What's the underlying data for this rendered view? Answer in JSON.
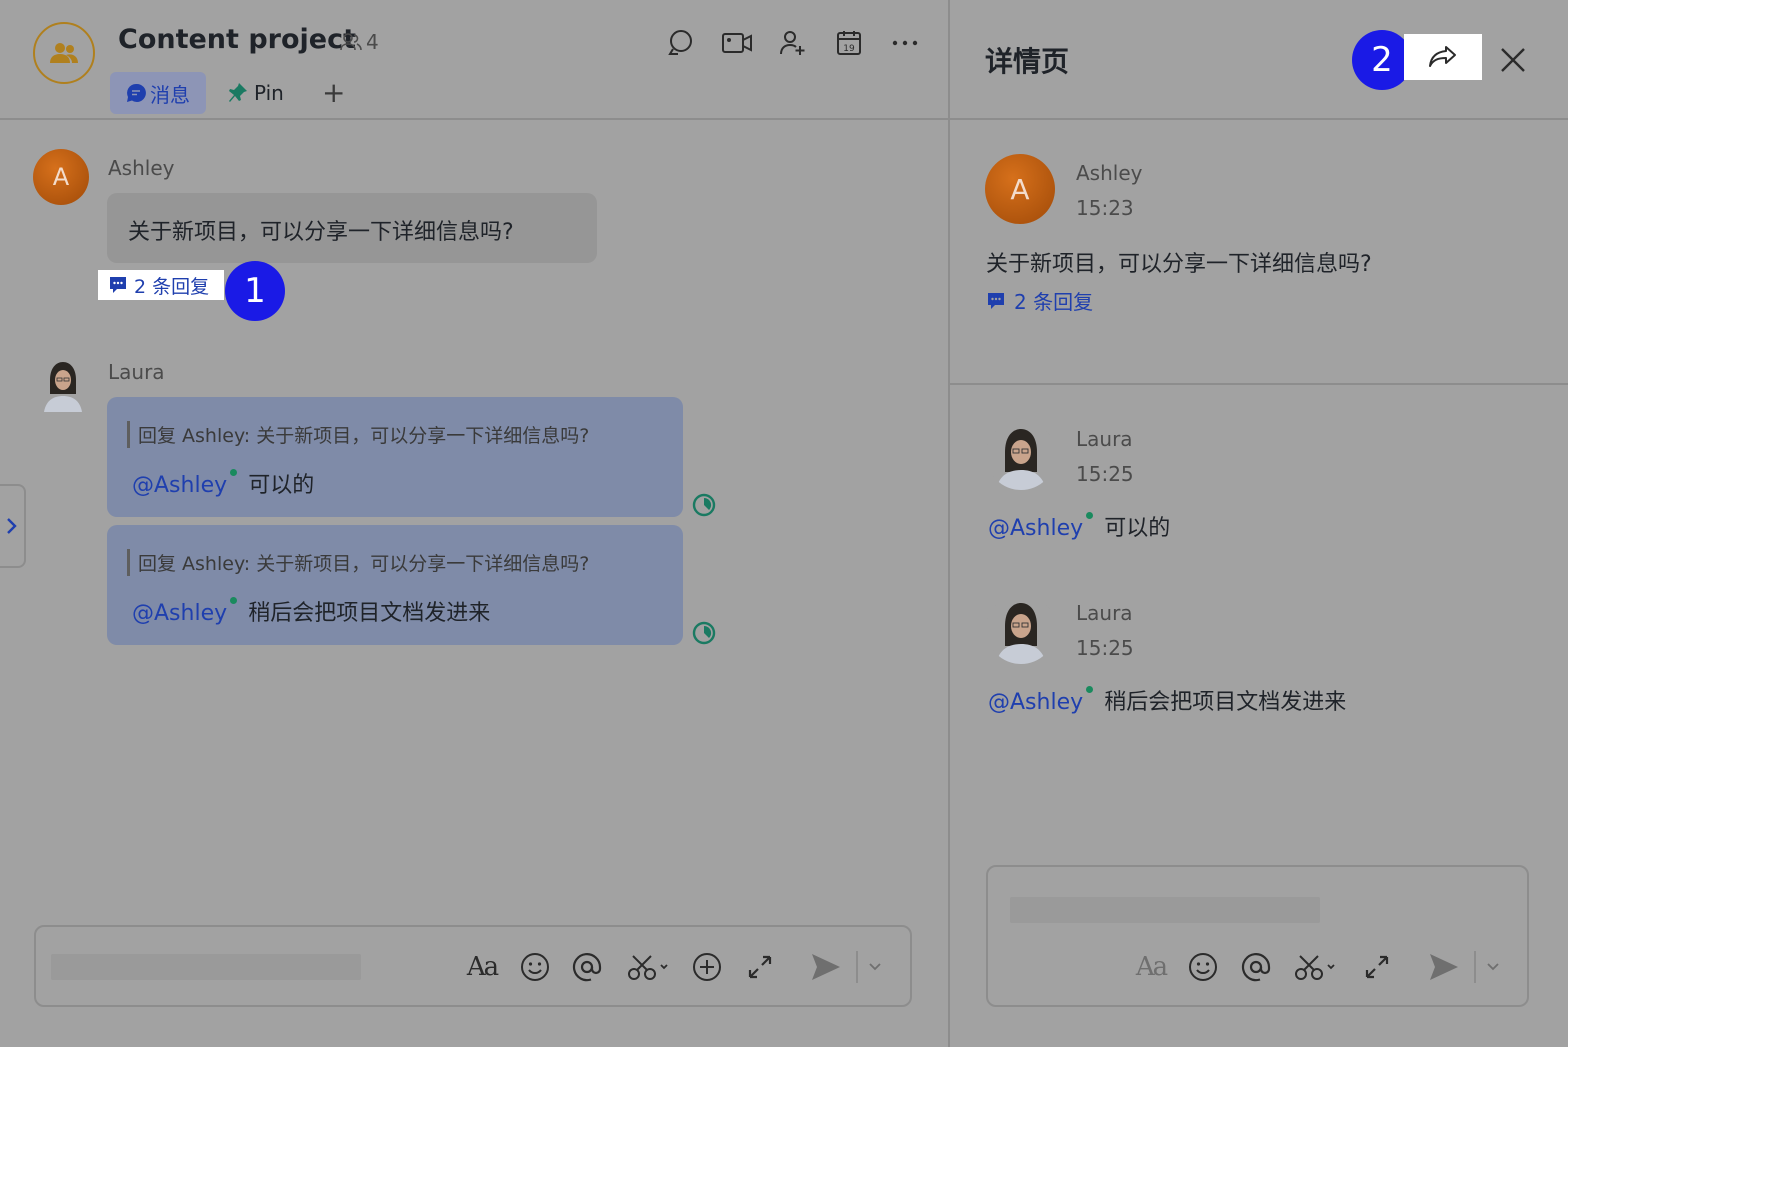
{
  "chat": {
    "title": "Content project",
    "member_count": "4",
    "tabs": {
      "messages": "消息",
      "pin": "Pin",
      "add": "+"
    }
  },
  "messages": [
    {
      "sender": "Ashley",
      "avatar_letter": "A",
      "text": "关于新项目，可以分享一下详细信息吗?",
      "replies_label": "2 条回复"
    },
    {
      "sender": "Laura",
      "quote": "回复 Ashley: 关于新项目，可以分享一下详细信息吗?",
      "mention": "@Ashley",
      "text": "可以的"
    },
    {
      "quote": "回复 Ashley: 关于新项目，可以分享一下详细信息吗?",
      "mention": "@Ashley",
      "text": "稍后会把项目文档发进来"
    }
  ],
  "badges": {
    "step1": "1",
    "step2": "2"
  },
  "detail": {
    "title": "详情页",
    "root": {
      "sender": "Ashley",
      "avatar_letter": "A",
      "time": "15:23",
      "text": "关于新项目，可以分享一下详细信息吗?",
      "replies_label": "2 条回复"
    },
    "replies": [
      {
        "sender": "Laura",
        "time": "15:25",
        "mention": "@Ashley",
        "text": "可以的"
      },
      {
        "sender": "Laura",
        "time": "15:25",
        "mention": "@Ashley",
        "text": "稍后会把项目文档发进来"
      }
    ]
  },
  "toolbar": {
    "format_glyph": "Aa"
  },
  "colors": {
    "accent": "#1f3fae",
    "badge": "#1a1ae6",
    "ashley_avatar": "#c2600f",
    "online": "#1a8a5e"
  }
}
